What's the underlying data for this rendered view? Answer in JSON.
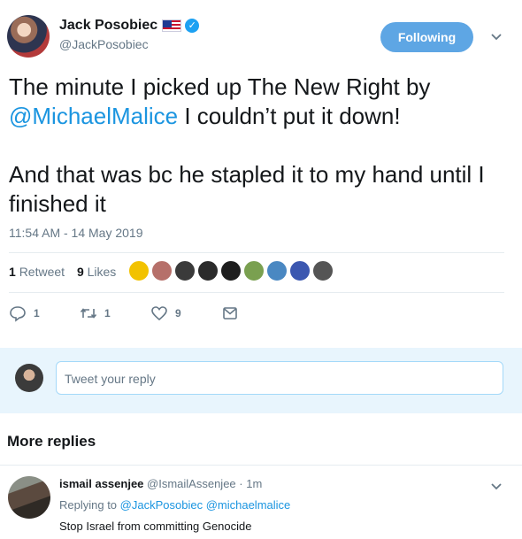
{
  "author": {
    "name": "Jack Posobiec",
    "handle": "@JackPosobiec",
    "follow_label": "Following"
  },
  "tweet": {
    "line1_pre": "The minute I picked up The New Right by",
    "mention": "@MichaelMalice",
    "line2_post": " I couldn’t put it down!",
    "para2": "And that was bc he stapled it to my hand until I finished it",
    "timestamp": "11:54 AM - 14 May 2019"
  },
  "stats": {
    "retweets_count": "1",
    "retweets_label": "Retweet",
    "likes_count": "9",
    "likes_label": "Likes"
  },
  "liker_colors": [
    "#f2c200",
    "#b6706a",
    "#3a3a3a",
    "#2b2b2b",
    "#1e1e1e",
    "#7aa050",
    "#4a88c2",
    "#3b57b0",
    "#555555"
  ],
  "actions": {
    "reply_count": "1",
    "retweet_count": "1",
    "like_count": "9"
  },
  "reply_box": {
    "placeholder": "Tweet your reply"
  },
  "more_replies_label": "More replies",
  "reply": {
    "name": "ismail assenjee",
    "handle": "@IsmailAssenjee",
    "time": "· 1m",
    "replying_prefix": "Replying to",
    "replying_to_1": "@JackPosobiec",
    "replying_to_2": "@michaelmalice",
    "text": "Stop Israel from committing  Genocide"
  },
  "colors": {
    "accent": "#1da1f2",
    "link": "#1b95e0",
    "follow_button": "#5ea6e4",
    "reply_box_bg": "#e8f5fd"
  }
}
